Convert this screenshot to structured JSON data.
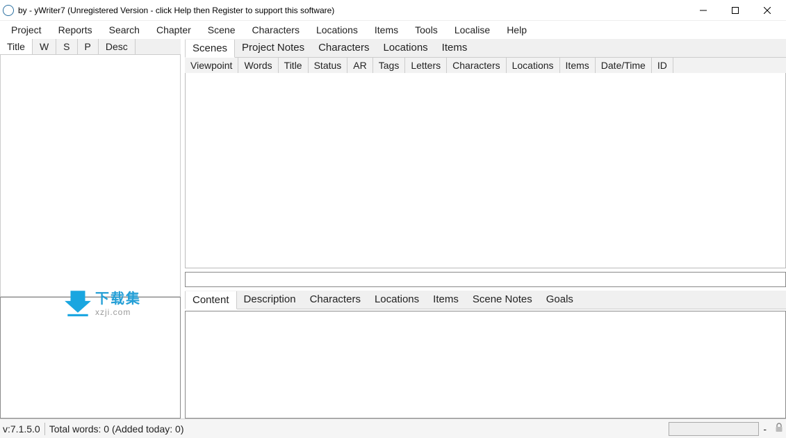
{
  "window": {
    "title": "by  - yWriter7 (Unregistered Version - click Help then Register to support this software)"
  },
  "menubar": [
    "Project",
    "Reports",
    "Search",
    "Chapter",
    "Scene",
    "Characters",
    "Locations",
    "Items",
    "Tools",
    "Localise",
    "Help"
  ],
  "leftTabs": [
    "Title",
    "W",
    "S",
    "P",
    "Desc"
  ],
  "topTabs": [
    "Scenes",
    "Project Notes",
    "Characters",
    "Locations",
    "Items"
  ],
  "gridCols": [
    "Viewpoint",
    "Words",
    "Title",
    "Status",
    "AR",
    "Tags",
    "Letters",
    "Characters",
    "Locations",
    "Items",
    "Date/Time",
    "ID"
  ],
  "bottomTabs": [
    "Content",
    "Description",
    "Characters",
    "Locations",
    "Items",
    "Scene Notes",
    "Goals"
  ],
  "status": {
    "version": "v:7.1.5.0",
    "words": "Total words: 0 (Added today: 0)",
    "dash": "-"
  },
  "watermark": {
    "cn": "下载集",
    "url": "xzji.com"
  }
}
